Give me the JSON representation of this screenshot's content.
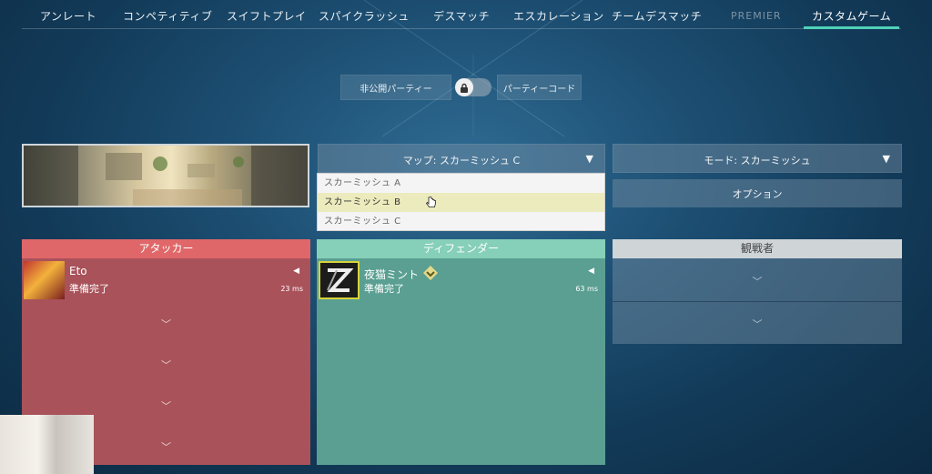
{
  "nav": {
    "tabs": [
      "アンレート",
      "コンペティティブ",
      "スイフトプレイ",
      "スパイクラッシュ",
      "デスマッチ",
      "エスカレーション",
      "チームデスマッチ",
      "PREMIER",
      "カスタムゲーム"
    ],
    "active_index": 8
  },
  "party": {
    "privacy_label": "非公開パーティー",
    "code_label": "パーティーコード",
    "locked": true
  },
  "map": {
    "select_label": "マップ: スカーミッシュ C",
    "options": [
      "スカーミッシュ A",
      "スカーミッシュ B",
      "スカーミッシュ C"
    ],
    "hovered_index": 1
  },
  "mode": {
    "select_label": "モード: スカーミッシュ",
    "options_button": "オプション"
  },
  "teams": {
    "attackers": {
      "title": "アタッカー",
      "player": {
        "name": "Eto",
        "status": "準備完了",
        "ping": "23 ms"
      },
      "empty_slots": 4
    },
    "defenders": {
      "title": "ディフェンダー",
      "player": {
        "name": "夜猫ミント",
        "status": "準備完了",
        "ping": "63 ms"
      }
    },
    "observers": {
      "title": "観戦者",
      "empty_slots": 2
    }
  },
  "colors": {
    "attackers_header": "#e06769",
    "defenders_header": "#86cfb9",
    "accent": "#4fd1b8"
  }
}
